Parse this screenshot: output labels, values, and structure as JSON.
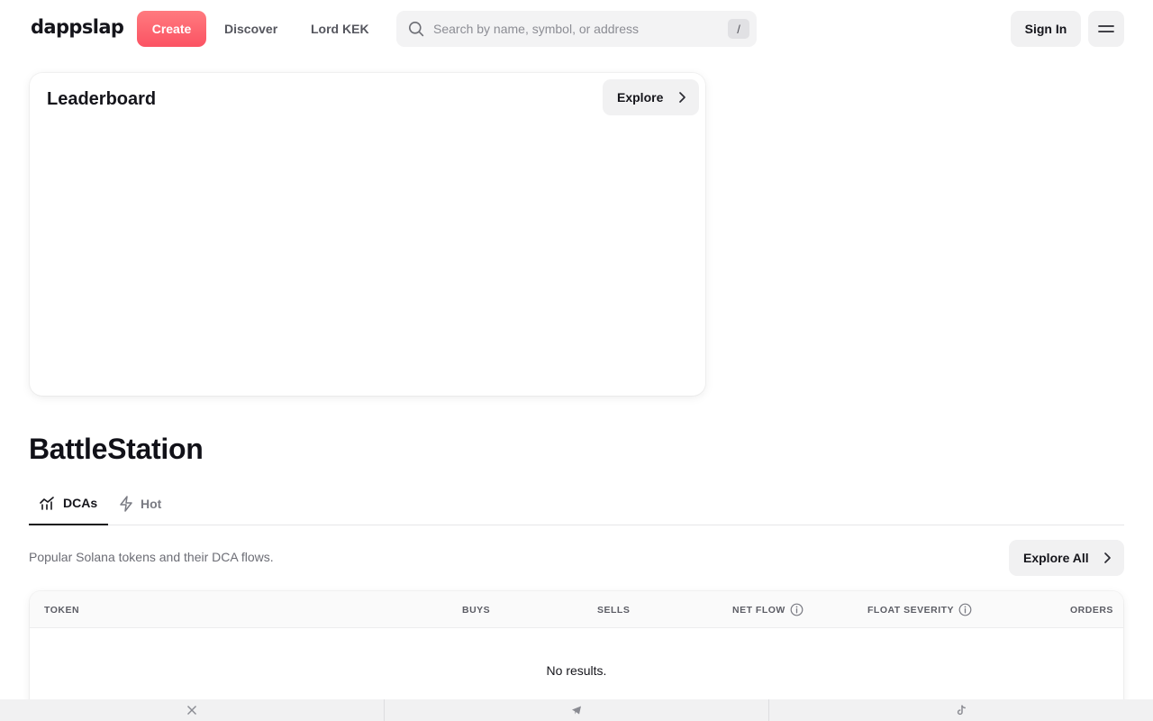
{
  "header": {
    "logo": "dappslap",
    "create_label": "Create",
    "nav": [
      {
        "label": "Discover"
      },
      {
        "label": "Lord KEK"
      }
    ],
    "search": {
      "placeholder": "Search by name, symbol, or address",
      "shortcut": "/",
      "icon": "search-icon"
    },
    "signin_label": "Sign In",
    "menu_icon": "menu-icon"
  },
  "leaderboard": {
    "title": "Leaderboard",
    "explore_label": "Explore"
  },
  "battlestation": {
    "title": "BattleStation",
    "tabs": [
      {
        "label": "DCAs",
        "icon": "chart-icon",
        "active": true
      },
      {
        "label": "Hot",
        "icon": "lightning-icon",
        "active": false
      }
    ],
    "description": "Popular Solana tokens and their DCA flows.",
    "explore_all_label": "Explore All",
    "table": {
      "columns": [
        "TOKEN",
        "BUYS",
        "SELLS",
        "NET FLOW",
        "FLOAT SEVERITY",
        "ORDERS"
      ],
      "empty_text": "No results."
    }
  },
  "footer": {
    "icons": [
      "x-icon",
      "telegram-icon",
      "tiktok-icon"
    ]
  }
}
